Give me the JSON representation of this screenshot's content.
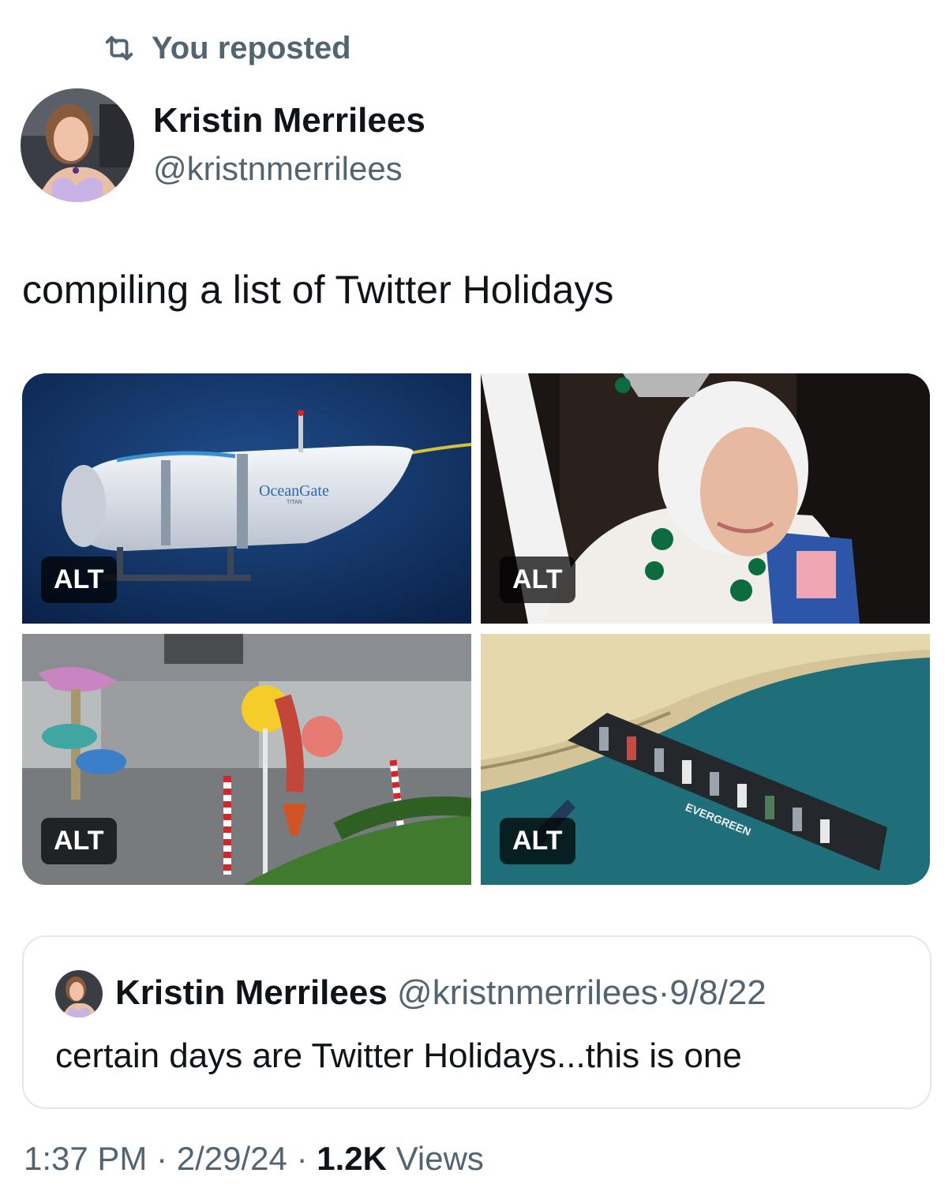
{
  "repost": {
    "icon": "repost-icon",
    "label": "You reposted"
  },
  "author": {
    "name": "Kristin Merrilees",
    "handle": "@kristnmerrilees"
  },
  "tweet": {
    "text": "compiling a list of Twitter Holidays"
  },
  "media": [
    {
      "alt_label": "ALT",
      "brand": "OceanGate",
      "sub": "TITAN"
    },
    {
      "alt_label": "ALT"
    },
    {
      "alt_label": "ALT"
    },
    {
      "alt_label": "ALT",
      "ship_text": "EVERGREEN"
    }
  ],
  "quote": {
    "name": "Kristin Merrilees",
    "handle": "@kristnmerrilees",
    "separator": "·",
    "date": "9/8/22",
    "text": "certain days are Twitter Holidays...this is one"
  },
  "footer": {
    "time": "1:37 PM",
    "sep1": "·",
    "date": "2/29/24",
    "sep2": "·",
    "views_count": "1.2K",
    "views_label": "Views"
  },
  "colors": {
    "secondary_text": "#536471",
    "primary_text": "#0f1419",
    "border": "#e3e7ea"
  }
}
